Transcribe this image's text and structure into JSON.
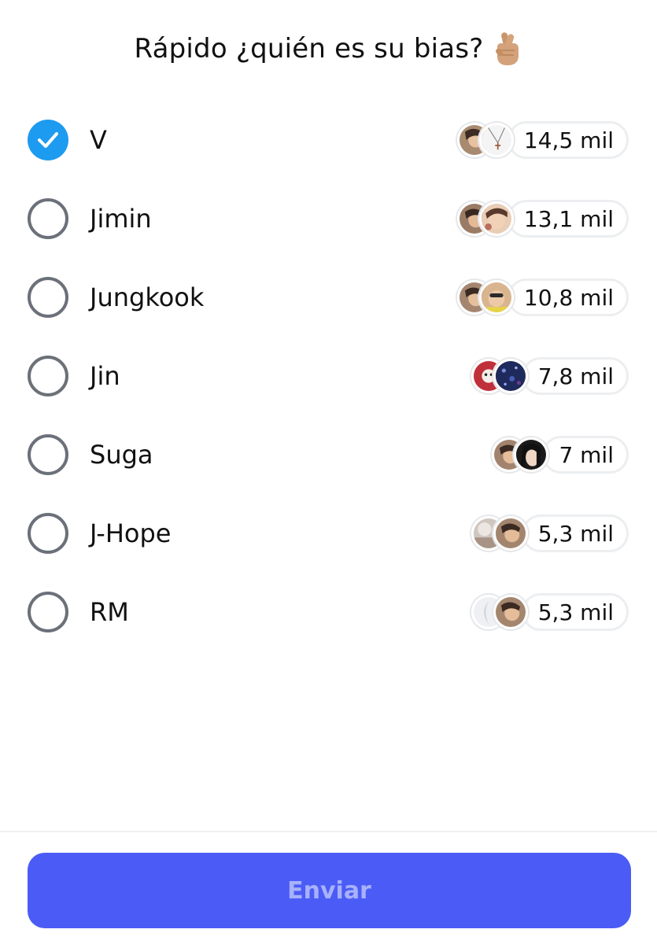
{
  "poll": {
    "title": "Rápido ¿quién es su bias?",
    "title_icon": "crossed-fingers-icon",
    "options": [
      {
        "label": "V",
        "count": "14,5 mil",
        "selected": true
      },
      {
        "label": "Jimin",
        "count": "13,1 mil",
        "selected": false
      },
      {
        "label": "Jungkook",
        "count": "10,8 mil",
        "selected": false
      },
      {
        "label": "Jin",
        "count": "7,8 mil",
        "selected": false
      },
      {
        "label": "Suga",
        "count": "7 mil",
        "selected": false
      },
      {
        "label": "J-Hope",
        "count": "5,3 mil",
        "selected": false
      },
      {
        "label": "RM",
        "count": "5,3 mil",
        "selected": false
      }
    ],
    "submit_label": "Enviar"
  },
  "colors": {
    "selected": "#1d9bf0",
    "radio_border": "#6b7079",
    "button_bg": "#4b5cf6",
    "button_text": "#a8b1fb"
  }
}
